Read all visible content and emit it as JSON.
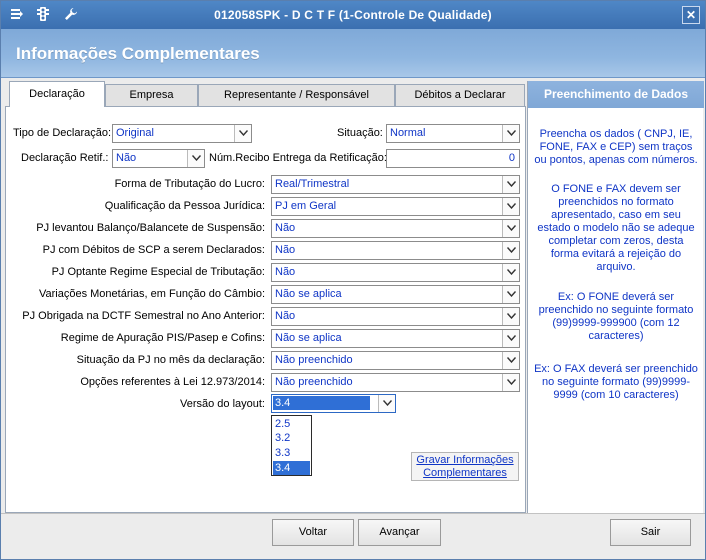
{
  "window": {
    "title": "012058SPK - D C T F (1-Controle De Qualidade)",
    "close_label": "✕"
  },
  "header": {
    "title": "Informações Complementares"
  },
  "tabs": [
    {
      "label": "Declaração"
    },
    {
      "label": "Empresa"
    },
    {
      "label": "Representante / Responsável"
    },
    {
      "label": "Débitos a Declarar"
    }
  ],
  "form": {
    "tipo_declaracao": {
      "label": "Tipo de Declaração:",
      "value": "Original"
    },
    "situacao": {
      "label": "Situação:",
      "value": "Normal"
    },
    "declaracao_retif": {
      "label": "Declaração Retif.:",
      "value": "Não"
    },
    "num_recibo": {
      "label": "Núm.Recibo Entrega da Retificação:",
      "value": "0"
    },
    "rows": [
      {
        "label": "Forma de Tributação do Lucro:",
        "value": "Real/Trimestral"
      },
      {
        "label": "Qualificação da Pessoa Jurídica:",
        "value": "PJ em Geral"
      },
      {
        "label": "PJ levantou Balanço/Balancete de Suspensão:",
        "value": "Não"
      },
      {
        "label": "PJ com Débitos de SCP a serem Declarados:",
        "value": "Não"
      },
      {
        "label": "PJ Optante Regime Especial de Tributação:",
        "value": "Não"
      },
      {
        "label": "Variações Monetárias, em Função do Câmbio:",
        "value": "Não se aplica"
      },
      {
        "label": "PJ Obrigada na DCTF Semestral no Ano Anterior:",
        "value": "Não"
      },
      {
        "label": "Regime de Apuração PIS/Pasep e Cofins:",
        "value": "Não se aplica"
      },
      {
        "label": "Situação da PJ no mês da declaração:",
        "value": "Não preenchido"
      },
      {
        "label": "Opções referentes à Lei 12.973/2014:",
        "value": "Não preenchido"
      }
    ],
    "versao_layout": {
      "label": "Versão do layout:",
      "value": "3.4",
      "options": [
        "2.5",
        "3.2",
        "3.3",
        "3.4"
      ]
    },
    "gravar_button": {
      "line1": "Gravar Informações",
      "line2": "Complementares"
    }
  },
  "side_panel": {
    "title": "Preenchimento de Dados",
    "paragraphs": [
      "Preencha os dados ( CNPJ, IE, FONE, FAX e CEP) sem traços ou pontos, apenas com números.",
      "O FONE e FAX  devem ser preenchidos no formato apresentado, caso em seu estado o modelo não se adeque completar com zeros, desta forma evitará a rejeição do arquivo.",
      "Ex: O FONE deverá ser preenchido no seguinte formato (99)9999-999900  (com 12 caracteres)",
      "Ex: O FAX deverá ser preenchido no seguinte formato (99)9999-9999  (com 10 caracteres)"
    ]
  },
  "footer": {
    "voltar": "Voltar",
    "avancar": "Avançar",
    "sair": "Sair"
  }
}
